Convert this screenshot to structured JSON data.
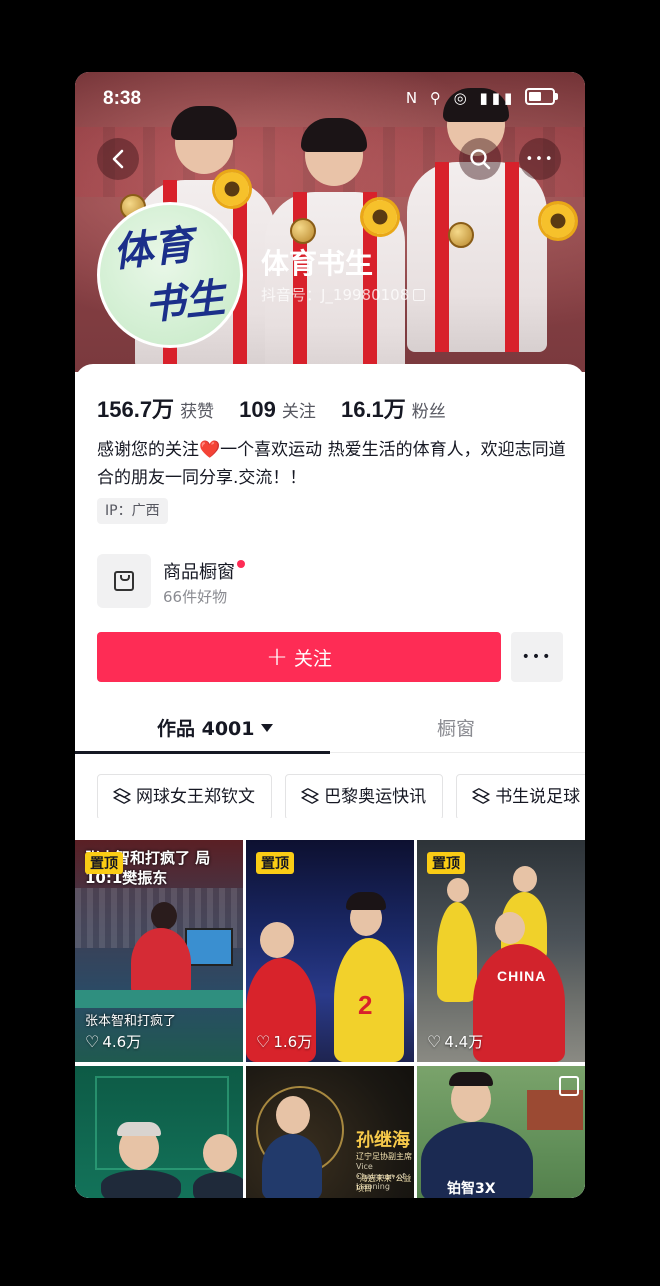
{
  "status_bar": {
    "time": "8:38",
    "icons": "N ⚲ ◎ ▮▮▮"
  },
  "header": {
    "back_icon": "chevron-left-icon",
    "search_icon": "search-icon",
    "more_icon": "more-icon",
    "more_glyph": "•••"
  },
  "profile": {
    "avatar_line1": "体育",
    "avatar_line2": "书生",
    "nickname": "体育书生",
    "douyin_id": "抖音号：J_19980108"
  },
  "stats": [
    {
      "value": "156.7万",
      "label": "获赞"
    },
    {
      "value": "109",
      "label": "关注"
    },
    {
      "value": "16.1万",
      "label": "粉丝"
    }
  ],
  "bio": {
    "before": "感谢您的关注",
    "heart": "❤️",
    "after": "一个喜欢运动 热爱生活的体育人，欢迎志同道合的朋友一同分享.交流！！"
  },
  "ip": "IP：广西",
  "shop": {
    "title": "商品橱窗",
    "subtitle": "66件好物"
  },
  "actions": {
    "follow_plus": "+",
    "follow_label": "关注",
    "more": "•••"
  },
  "tabs": {
    "works": "作品 4001",
    "window": "橱窗"
  },
  "collections": [
    "网球女王郑钦文",
    "巴黎奥运快讯",
    "书生说足球"
  ],
  "videos": [
    {
      "pinned": "置顶",
      "caption": "张本智和打疯了 局10:1樊振东",
      "subcaption": "张本智和打疯了",
      "likes": "4.6万"
    },
    {
      "pinned": "置顶",
      "likes": "1.6万"
    },
    {
      "pinned": "置顶",
      "team": "CHINA",
      "likes": "4.4万"
    },
    {},
    {
      "name": "孙继海",
      "title": "辽宁足协副主席",
      "title_en": "Vice Chairman of Liaoning",
      "note": "\"海选未来\"公益项目"
    },
    {
      "jersey": "铂智3X"
    }
  ],
  "colors": {
    "accent": "#fe2c55",
    "pin": "#facc15"
  }
}
